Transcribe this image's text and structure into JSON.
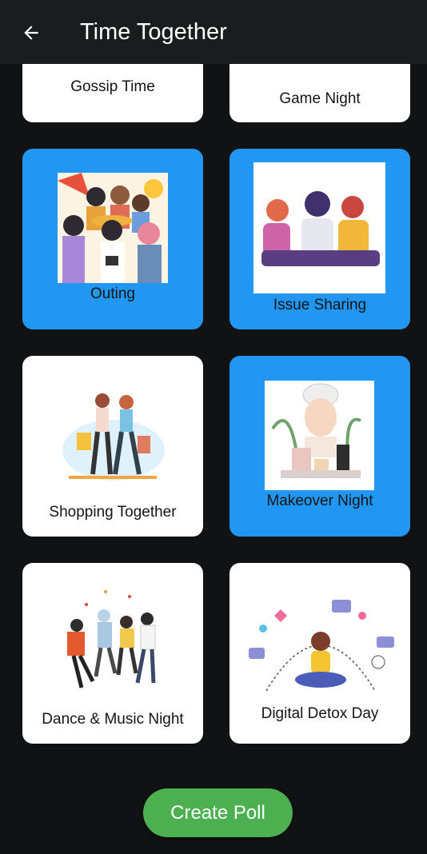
{
  "appbar": {
    "title": "Time Together",
    "back_icon": "arrow-left-icon"
  },
  "colors": {
    "background": "#111213",
    "appbar": "#1b1c1e",
    "card": "#ffffff",
    "card_selected": "#2196f3",
    "primary_button": "#4caf50"
  },
  "activities": [
    {
      "label": "Gossip Time",
      "selected": false
    },
    {
      "label": "Game Night",
      "selected": false
    },
    {
      "label": "Outing",
      "selected": true
    },
    {
      "label": "Issue Sharing",
      "selected": true
    },
    {
      "label": "Shopping Together",
      "selected": false
    },
    {
      "label": "Makeover Night",
      "selected": true
    },
    {
      "label": "Dance & Music Night",
      "selected": false
    },
    {
      "label": "Digital Detox Day",
      "selected": false
    }
  ],
  "create_poll": {
    "label": "Create Poll"
  }
}
